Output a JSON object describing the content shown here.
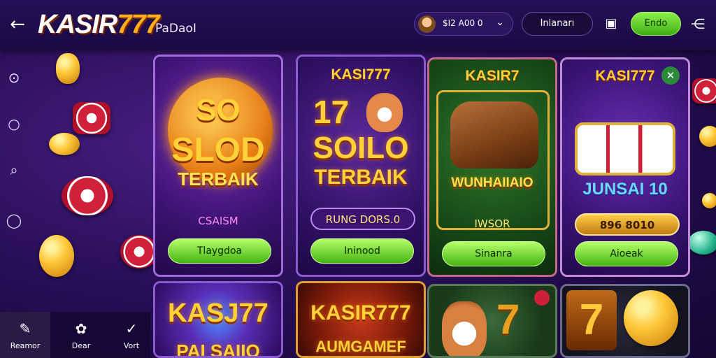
{
  "header": {
    "back": "←",
    "logo_main": "KASIR",
    "logo_accent": "777",
    "subtitle": "PaDaoI",
    "balance": "$I2 A00 0",
    "login_label": "Inlanarı",
    "register_label": "Endo"
  },
  "sidebar": {
    "icons": [
      "bell-search-icon",
      "search-icon",
      "magnifier-icon",
      "chat-icon"
    ]
  },
  "bottom_nav": {
    "items": [
      {
        "label": "Reamor",
        "icon": "✎"
      },
      {
        "label": "Dear",
        "icon": "✿"
      },
      {
        "label": "Vort",
        "icon": "✓"
      }
    ]
  },
  "games": [
    {
      "title": "",
      "line1": "SO",
      "line2": "SLOD",
      "line3": "TERBAIK",
      "caption": "CSAISM",
      "button": "Tlaygdoa"
    },
    {
      "title": "KASI777",
      "line1": "17",
      "line2": "SOILO",
      "line3": "TERBAIK",
      "caption": "RUNG DORS.0",
      "button": "Ininood"
    },
    {
      "title": "KASIR7",
      "line1": "",
      "line2": "",
      "line3": "WUNHAIIAIO",
      "caption": "IWSOR",
      "button": "Sinanra"
    },
    {
      "title": "KASI777",
      "line1": "",
      "line2": "",
      "line3": "JUNSAI 10",
      "caption": "896 8010",
      "button": "Aioeak"
    },
    {
      "title": "",
      "line1": "",
      "line2": "KASJ77",
      "line3": "PAI SAIIO",
      "caption": "",
      "button": ""
    },
    {
      "title": "",
      "line1": "",
      "line2": "KASIR777",
      "line3": "AUMGAMEF",
      "caption": "",
      "button": ""
    },
    {
      "title": "",
      "line1": "",
      "line2": "",
      "line3": "",
      "caption": "",
      "button": ""
    },
    {
      "title": "",
      "line1": "",
      "line2": "",
      "line3": "",
      "caption": "",
      "button": ""
    }
  ],
  "colors": {
    "accent_gold": "#ffcf3a",
    "play_green": "#44b512",
    "bg": "#2a0f5a"
  }
}
